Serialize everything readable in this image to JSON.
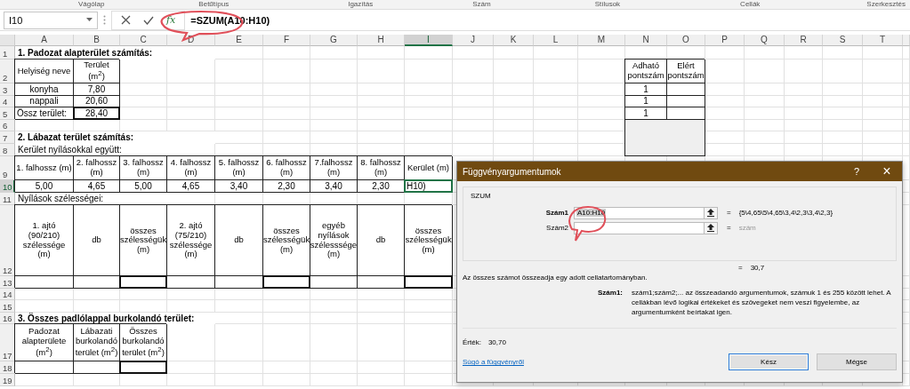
{
  "ribbon_groups": [
    "Vágólap",
    "Betűtípus",
    "Igazítás",
    "Szám",
    "Stílusok",
    "Cellák",
    "Szerkesztés"
  ],
  "formula_bar": {
    "name_box": "I10",
    "function_button": "fx",
    "formula": "=SZUM(A10:H10)"
  },
  "columns": [
    {
      "label": "A",
      "selected": false
    },
    {
      "label": "B",
      "selected": false
    },
    {
      "label": "C",
      "selected": false
    },
    {
      "label": "D",
      "selected": false
    },
    {
      "label": "E",
      "selected": false
    },
    {
      "label": "F",
      "selected": false
    },
    {
      "label": "G",
      "selected": false
    },
    {
      "label": "H",
      "selected": false
    },
    {
      "label": "I",
      "selected": true
    },
    {
      "label": "J",
      "selected": false
    },
    {
      "label": "K",
      "selected": false
    },
    {
      "label": "L",
      "selected": false
    },
    {
      "label": "M",
      "selected": false
    },
    {
      "label": "N",
      "selected": false
    },
    {
      "label": "O",
      "selected": false
    },
    {
      "label": "P",
      "selected": false
    },
    {
      "label": "Q",
      "selected": false
    },
    {
      "label": "R",
      "selected": false
    },
    {
      "label": "S",
      "selected": false
    },
    {
      "label": "T",
      "selected": false
    }
  ],
  "rows": [
    {
      "number": "1",
      "selected": false,
      "cells": [
        {
          "kind": "title",
          "text": "1. Padozat alapterület számítás:"
        }
      ]
    },
    {
      "number": "2",
      "selected": false,
      "cells": [
        {
          "kind": "head",
          "text": "Helyiség neve"
        },
        {
          "kind": "head",
          "text": "Terület (m$^{2}$)"
        },
        {
          "kind": "blank"
        },
        {
          "kind": "blank"
        },
        {
          "kind": "blank"
        },
        {
          "kind": "blank"
        },
        {
          "kind": "blank"
        },
        {
          "kind": "blank"
        },
        {
          "kind": "blank"
        },
        {
          "kind": "blank"
        },
        {
          "kind": "blank"
        },
        {
          "kind": "blank"
        },
        {
          "kind": "blank"
        },
        {
          "kind": "head",
          "text": "Adható pontszám"
        },
        {
          "kind": "head",
          "text": "Elért pontszám"
        }
      ]
    },
    {
      "number": "3",
      "selected": false,
      "cells": [
        {
          "kind": "value",
          "text": "konyha"
        },
        {
          "kind": "value",
          "text": "7,80"
        },
        {
          "kind": "blank"
        },
        {
          "kind": "blank"
        },
        {
          "kind": "blank"
        },
        {
          "kind": "blank"
        },
        {
          "kind": "blank"
        },
        {
          "kind": "blank"
        },
        {
          "kind": "blank"
        },
        {
          "kind": "blank"
        },
        {
          "kind": "blank"
        },
        {
          "kind": "blank"
        },
        {
          "kind": "blank"
        },
        {
          "kind": "value",
          "text": "1"
        },
        {
          "kind": "box"
        }
      ]
    },
    {
      "number": "4",
      "selected": false,
      "cells": [
        {
          "kind": "value",
          "text": "nappali"
        },
        {
          "kind": "value",
          "text": "20,60"
        },
        {
          "kind": "blank"
        },
        {
          "kind": "blank"
        },
        {
          "kind": "blank"
        },
        {
          "kind": "blank"
        },
        {
          "kind": "blank"
        },
        {
          "kind": "blank"
        },
        {
          "kind": "blank"
        },
        {
          "kind": "blank"
        },
        {
          "kind": "blank"
        },
        {
          "kind": "blank"
        },
        {
          "kind": "blank"
        },
        {
          "kind": "value",
          "text": "1"
        },
        {
          "kind": "box"
        }
      ]
    },
    {
      "number": "5",
      "selected": false,
      "cells": [
        {
          "kind": "text_box",
          "text": "Össz terület:"
        },
        {
          "kind": "total",
          "text": "28,40"
        },
        {
          "kind": "blank"
        },
        {
          "kind": "blank"
        },
        {
          "kind": "blank"
        },
        {
          "kind": "blank"
        },
        {
          "kind": "blank"
        },
        {
          "kind": "blank"
        },
        {
          "kind": "blank"
        },
        {
          "kind": "blank"
        },
        {
          "kind": "blank"
        },
        {
          "kind": "blank"
        },
        {
          "kind": "blank"
        },
        {
          "kind": "value",
          "text": "1"
        },
        {
          "kind": "box"
        }
      ]
    },
    {
      "number": "6",
      "selected": false,
      "cells": [
        {
          "kind": "blank"
        },
        {
          "kind": "blank"
        },
        {
          "kind": "blank"
        },
        {
          "kind": "blank"
        },
        {
          "kind": "blank"
        },
        {
          "kind": "blank"
        },
        {
          "kind": "blank"
        },
        {
          "kind": "blank"
        },
        {
          "kind": "blank"
        },
        {
          "kind": "blank"
        },
        {
          "kind": "blank"
        },
        {
          "kind": "blank"
        },
        {
          "kind": "blank"
        },
        {
          "kind": "shaded"
        }
      ]
    },
    {
      "number": "7",
      "selected": false,
      "cells": [
        {
          "kind": "title",
          "text": "2. Lábazat terület számítás:"
        }
      ]
    },
    {
      "number": "8",
      "selected": false,
      "cells": [
        {
          "kind": "note",
          "text": "Kerület nyílásokkal együtt:"
        }
      ]
    },
    {
      "number": "9",
      "selected": false,
      "cells": [
        {
          "kind": "head",
          "text": "1. falhossz (m)"
        },
        {
          "kind": "head",
          "text": "2. falhossz (m)"
        },
        {
          "kind": "head",
          "text": "3. falhossz (m)"
        },
        {
          "kind": "head",
          "text": "4. falhossz (m)"
        },
        {
          "kind": "head",
          "text": "5. falhossz (m)"
        },
        {
          "kind": "head",
          "text": "6. falhossz (m)"
        },
        {
          "kind": "head",
          "text": "7.falhossz (m)"
        },
        {
          "kind": "head",
          "text": "8. falhossz (m)"
        },
        {
          "kind": "head",
          "text": "Kerület (m)"
        }
      ]
    },
    {
      "number": "10",
      "selected": true,
      "cells": [
        {
          "kind": "value",
          "text": "5,00"
        },
        {
          "kind": "value",
          "text": "4,65"
        },
        {
          "kind": "value",
          "text": "5,00"
        },
        {
          "kind": "value",
          "text": "4,65"
        },
        {
          "kind": "value",
          "text": "3,40"
        },
        {
          "kind": "value",
          "text": "2,30"
        },
        {
          "kind": "value",
          "text": "3,40"
        },
        {
          "kind": "value",
          "text": "2,30"
        },
        {
          "kind": "text_box",
          "text": "H10)"
        }
      ]
    },
    {
      "number": "11",
      "selected": false,
      "cells": [
        {
          "kind": "note",
          "text": "Nyílások szélességei:"
        }
      ]
    },
    {
      "number": "12",
      "selected": false,
      "cells": [
        {
          "kind": "head",
          "text": "1. ajtó (90/210) szélessége (m)"
        },
        {
          "kind": "head",
          "text": "db"
        },
        {
          "kind": "head",
          "text": "összes szélességük (m)"
        },
        {
          "kind": "head",
          "text": "2. ajtó (75/210) szélessége (m)"
        },
        {
          "kind": "head",
          "text": "db"
        },
        {
          "kind": "head",
          "text": "összes szélességük (m)"
        },
        {
          "kind": "head",
          "text": "egyéb nyílások szélesssége (m)"
        },
        {
          "kind": "head",
          "text": "db"
        },
        {
          "kind": "head",
          "text": "összes szélességük (m)"
        }
      ]
    },
    {
      "number": "13",
      "selected": false,
      "cells": [
        {
          "kind": "box"
        },
        {
          "kind": "box"
        },
        {
          "kind": "thick_box"
        },
        {
          "kind": "box"
        },
        {
          "kind": "box"
        },
        {
          "kind": "thick_box"
        },
        {
          "kind": "box"
        },
        {
          "kind": "box"
        },
        {
          "kind": "thick_box"
        }
      ]
    },
    {
      "number": "14",
      "selected": false,
      "cells": []
    },
    {
      "number": "15",
      "selected": false,
      "cells": []
    },
    {
      "number": "16",
      "selected": false,
      "cells": [
        {
          "kind": "title",
          "text": "3. Összes padlólappal burkolandó terület:"
        }
      ]
    },
    {
      "number": "17",
      "selected": false,
      "cells": [
        {
          "kind": "head",
          "text": "Padozat alapterülete (m$^{2}$)"
        },
        {
          "kind": "head",
          "text": "Lábazati burkolandó terület (m$^{2}$)"
        },
        {
          "kind": "head",
          "text": "Összes burkolandó terület (m$^{2}$)"
        }
      ]
    },
    {
      "number": "18",
      "selected": false,
      "cells": [
        {
          "kind": "box"
        },
        {
          "kind": "box"
        },
        {
          "kind": "thick_box"
        }
      ]
    },
    {
      "number": "19",
      "selected": false,
      "cells": []
    }
  ],
  "dialog": {
    "title": "Függvényargumentumok",
    "help": "?",
    "close": "×",
    "function": "SZUM",
    "arguments": [
      {
        "label": "Szám1",
        "value": "A10:H10",
        "operator": "=",
        "result": "{5\\4,65\\5\\4,65\\3,4\\2,3\\3,4\\2,3}",
        "selected": true
      },
      {
        "label": "Szám2",
        "operator": "=",
        "result": "szám",
        "selected": false
      }
    ],
    "total": {
      "operator": "=",
      "value": "30,7"
    },
    "description": "Az összes számot összeadja egy adott cellatartományban.",
    "argument_help": {
      "label": "Szám1:",
      "text": "szám1;szám2;... az összeadandó argumentumok, számuk 1 és 255 között lehet. A cellákban lévő logikai értékeket és szövegeket nem veszi figyelembe, az argumentumként beírtakat igen."
    },
    "result": {
      "label": "Érték:",
      "value": "30,70"
    },
    "link": "Súgó a függvényről",
    "buttons": [
      {
        "label": "Kész",
        "selected": true
      },
      {
        "label": "Mégse",
        "selected": false
      }
    ]
  }
}
